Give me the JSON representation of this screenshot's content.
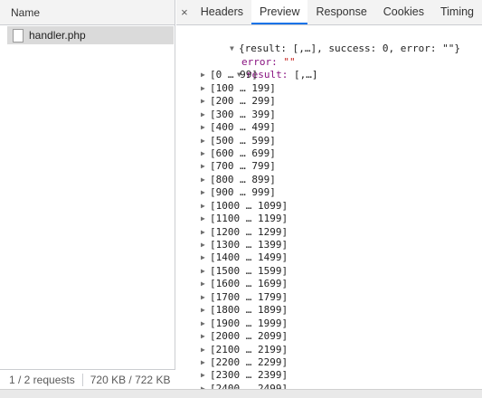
{
  "request_list": {
    "header": "Name",
    "items": [
      {
        "name": "handler.php"
      }
    ]
  },
  "status": {
    "requests": "1 / 2 requests",
    "size": "720 KB / 722 KB"
  },
  "tabs": {
    "close_icon": "×",
    "items": [
      "Headers",
      "Preview",
      "Response",
      "Cookies",
      "Timing"
    ],
    "active": "Preview"
  },
  "preview": {
    "root_summary": "{result: [,…], success: 0, error: \"\"}",
    "error_key": "error:",
    "error_value": "\"\"",
    "result_key": "result:",
    "result_summary": "[,…]",
    "ranges": [
      "[0 … 99]",
      "[100 … 199]",
      "[200 … 299]",
      "[300 … 399]",
      "[400 … 499]",
      "[500 … 599]",
      "[600 … 699]",
      "[700 … 799]",
      "[800 … 899]",
      "[900 … 999]",
      "[1000 … 1099]",
      "[1100 … 1199]",
      "[1200 … 1299]",
      "[1300 … 1399]",
      "[1400 … 1499]",
      "[1500 … 1599]",
      "[1600 … 1699]",
      "[1700 … 1799]",
      "[1800 … 1899]",
      "[1900 … 1999]",
      "[2000 … 2099]",
      "[2100 … 2199]",
      "[2200 … 2299]",
      "[2300 … 2399]",
      "[2400 … 2499]"
    ]
  },
  "icons": {
    "expanded": "expanded-triangle-icon",
    "collapsed": "collapsed-triangle-icon",
    "file": "file-icon"
  },
  "colors": {
    "active_tab_underline": "#1a73e8",
    "key": "#881280",
    "string": "#c41a16"
  }
}
